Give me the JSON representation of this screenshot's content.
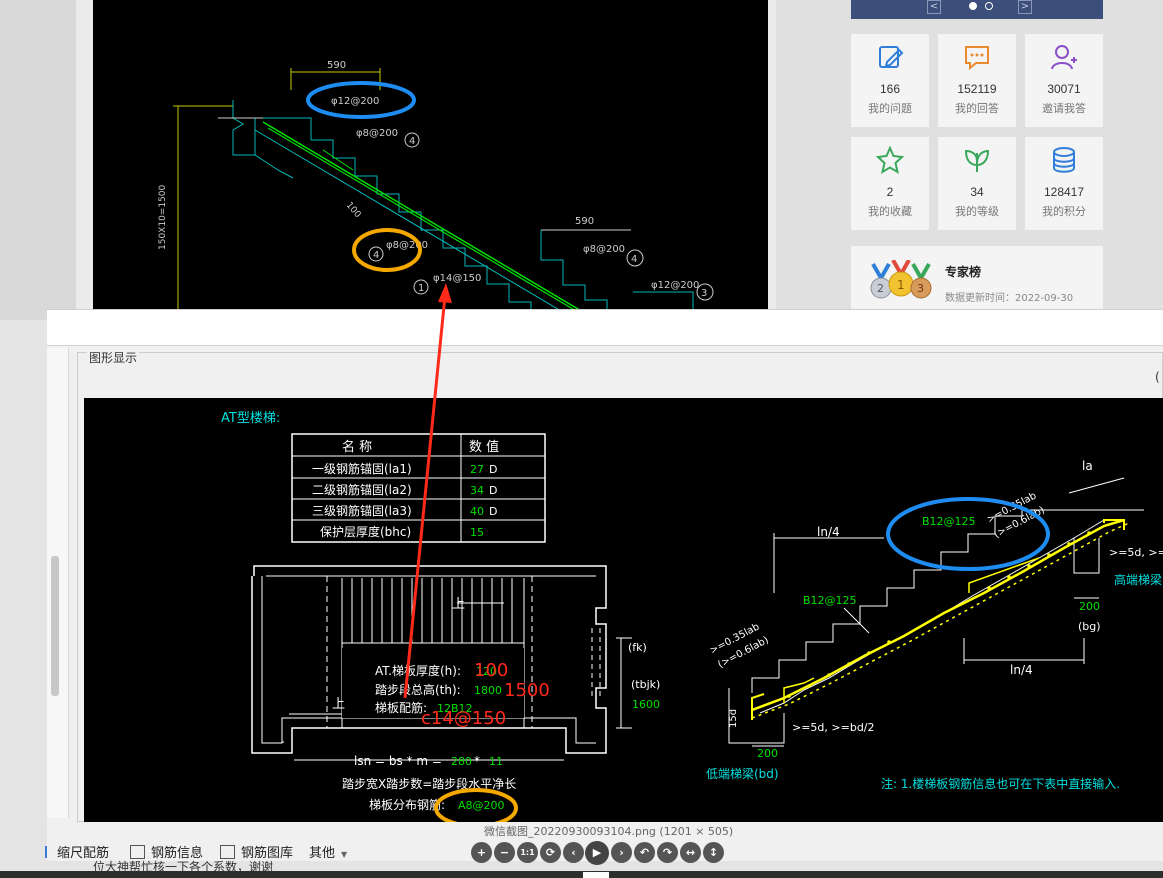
{
  "sidebar": {
    "banner": {
      "prev": "<",
      "next": ">"
    },
    "stats": [
      {
        "num": "166",
        "label": "我的问题",
        "icon": "edit-icon",
        "color": "#2f7fd8"
      },
      {
        "num": "152119",
        "label": "我的回答",
        "icon": "chat-icon",
        "color": "#e98a2e"
      },
      {
        "num": "30071",
        "label": "邀请我答",
        "icon": "add-user-icon",
        "color": "#8a4fc9"
      },
      {
        "num": "2",
        "label": "我的收藏",
        "icon": "star-icon",
        "color": "#3aa85a"
      },
      {
        "num": "34",
        "label": "我的等级",
        "icon": "leaf-icon",
        "color": "#3aa85a"
      },
      {
        "num": "128417",
        "label": "我的积分",
        "icon": "coins-icon",
        "color": "#2f7fd8"
      }
    ],
    "expert": {
      "title": "专家榜",
      "updated": "数据更新时间：2022-09-30",
      "medals": [
        "2",
        "1",
        "3"
      ]
    }
  },
  "top_cad": {
    "dim1": "590",
    "dim2": "590",
    "dim_side": "150X10=1500",
    "slope": "100",
    "rebar_top": "φ12@200",
    "rebar_4a": "φ8@200",
    "rebar_mid": "φ8@200",
    "rebar_4b": "φ8@200",
    "rebar_main": "φ14@150",
    "rebar_3": "φ12@200",
    "mark_4": "4",
    "mark_1": "1",
    "mark_3": "3"
  },
  "window": {
    "group_title": "图形显示",
    "paren": "(",
    "drawing": {
      "title": "AT型楼梯:",
      "table_headers": [
        "名  称",
        "数  值"
      ],
      "table_rows": [
        {
          "name": "一级钢筋锚固(la1)",
          "value": "27",
          "unit": "D"
        },
        {
          "name": "二级钢筋锚固(la2)",
          "value": "34",
          "unit": "D"
        },
        {
          "name": "三级钢筋锚固(la3)",
          "value": "40",
          "unit": "D"
        },
        {
          "name": "保护层厚度(bhc)",
          "value": "15",
          "unit": ""
        }
      ],
      "up_label": "上",
      "thickness_label": "AT.梯板厚度(h):",
      "thickness_value": "120",
      "height_label": "踏步段总高(th):",
      "height_value": "1800",
      "rebar_label": "梯板配筋:",
      "rebar_value": "12B12",
      "lsn_formula": "lsn = bs * m = ",
      "lsn_bs": "280",
      "lsn_m": "11",
      "lsn_desc": "踏步宽X踏步数=踏步段水平净长",
      "dist_label": "梯板分布钢筋:",
      "dist_value": "A8@200",
      "fk": "(fk)",
      "tbjk": "(tbjk)",
      "tbjk_value": "1600",
      "note_h": "100",
      "note_th": "1500",
      "note_rebar": "c14@150",
      "la": "la",
      "ln4_top": "ln/4",
      "ln4_bottom": "ln/4",
      "b12_upper": "B12@125",
      "b12_lower": "B12@125",
      "anc_upper": ">=0.35lab",
      "anc_upper2": "(>=0.6lab)",
      "anc_lower": ">=0.35lab",
      "anc_lower2": "(>=0.6lab)",
      "d5_upper": ">=5d, >=",
      "high_beam": "高端梯梁",
      "dim_200_right": "200",
      "bg": "(bg)",
      "d15": "15d",
      "d5_lower": ">=5d, >=bd/2",
      "dim_200_left": "200",
      "low_beam": "低端梯梁(bd)",
      "note": "注: 1.楼梯板钢筋信息也可在下表中直接输入."
    },
    "toolbar": [
      {
        "label": "缩尺配筋",
        "icon": "scale-icon"
      },
      {
        "label": "钢筋信息",
        "icon": "list-icon"
      },
      {
        "label": "钢筋图库",
        "icon": "library-icon"
      },
      {
        "label": "其他",
        "icon": "dropdown-icon"
      }
    ]
  },
  "viewer": {
    "caption": "微信截图_20220930093104.png (1201 × 505)",
    "buttons": [
      "+",
      "−",
      "1:1",
      "⟳",
      "‹",
      "▶",
      "›",
      "↶",
      "↷",
      "↔",
      "↕"
    ]
  },
  "under_text": "位大神帮忙核一下各个系数，谢谢",
  "colors": {
    "annotation_blue": "#1e8cf0",
    "annotation_orange": "#f5a800",
    "arrow_red": "#ff2a1a",
    "cad_green": "#00e000",
    "cad_yellow": "#ffff00",
    "cad_cyan": "#00ffff"
  }
}
